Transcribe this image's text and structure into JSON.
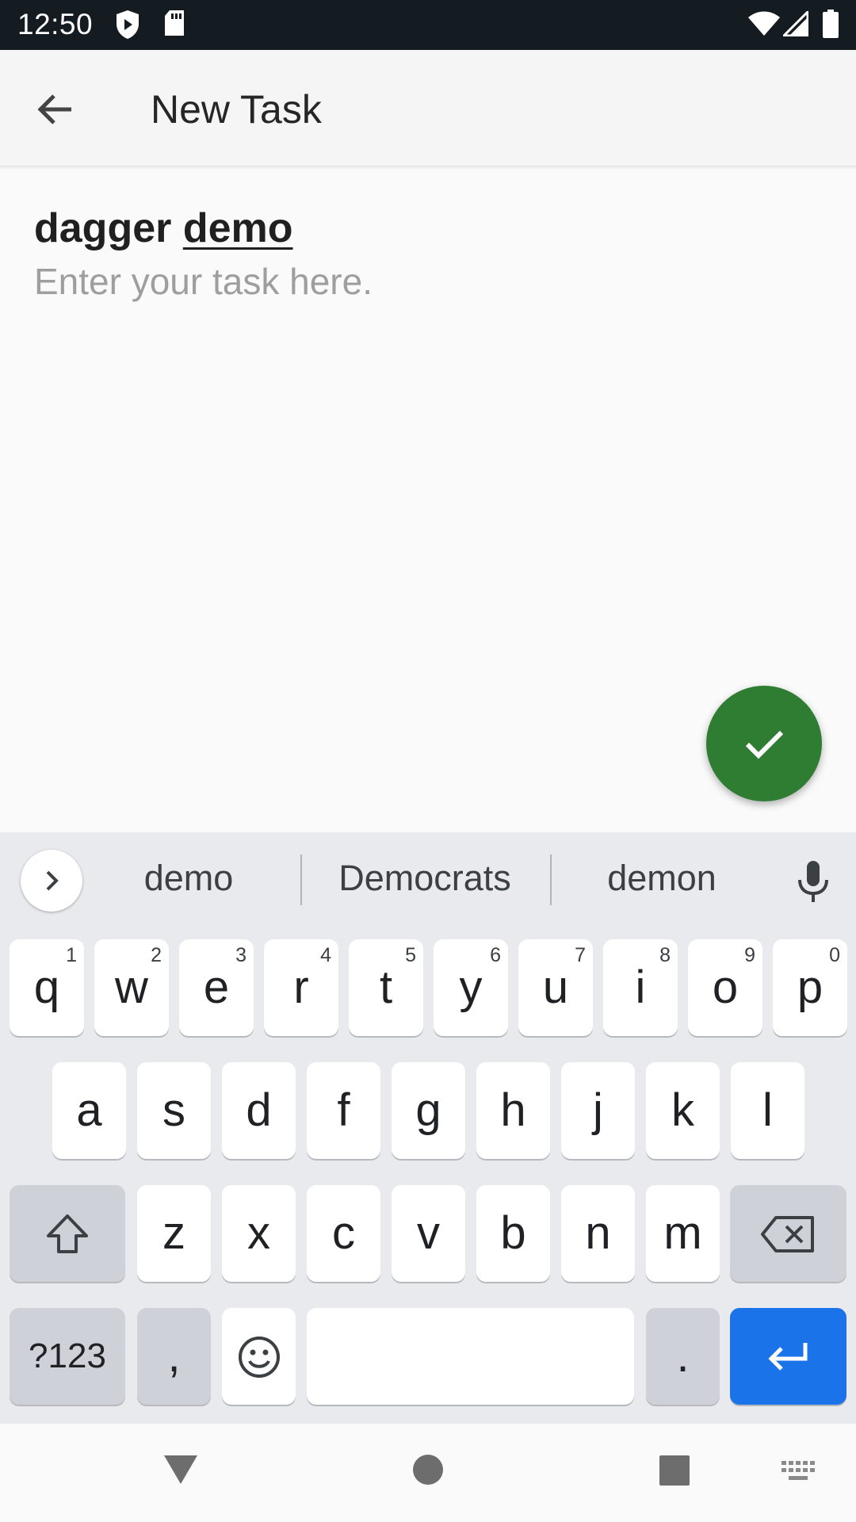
{
  "status_bar": {
    "time": "12:50"
  },
  "app_bar": {
    "title": "New Task"
  },
  "task": {
    "title_word1": "dagger",
    "title_word2": "demo",
    "placeholder": "Enter your task here."
  },
  "keyboard": {
    "suggestions": [
      "demo",
      "Democrats",
      "demon"
    ],
    "row1": [
      {
        "k": "q",
        "h": "1"
      },
      {
        "k": "w",
        "h": "2"
      },
      {
        "k": "e",
        "h": "3"
      },
      {
        "k": "r",
        "h": "4"
      },
      {
        "k": "t",
        "h": "5"
      },
      {
        "k": "y",
        "h": "6"
      },
      {
        "k": "u",
        "h": "7"
      },
      {
        "k": "i",
        "h": "8"
      },
      {
        "k": "o",
        "h": "9"
      },
      {
        "k": "p",
        "h": "0"
      }
    ],
    "row2": [
      "a",
      "s",
      "d",
      "f",
      "g",
      "h",
      "j",
      "k",
      "l"
    ],
    "row3": [
      "z",
      "x",
      "c",
      "v",
      "b",
      "n",
      "m"
    ],
    "symbols_label": "?123",
    "comma_label": ",",
    "period_label": "."
  },
  "colors": {
    "fab": "#2e7d32",
    "enter_key": "#1a73e8",
    "status_bar": "#141b21"
  }
}
